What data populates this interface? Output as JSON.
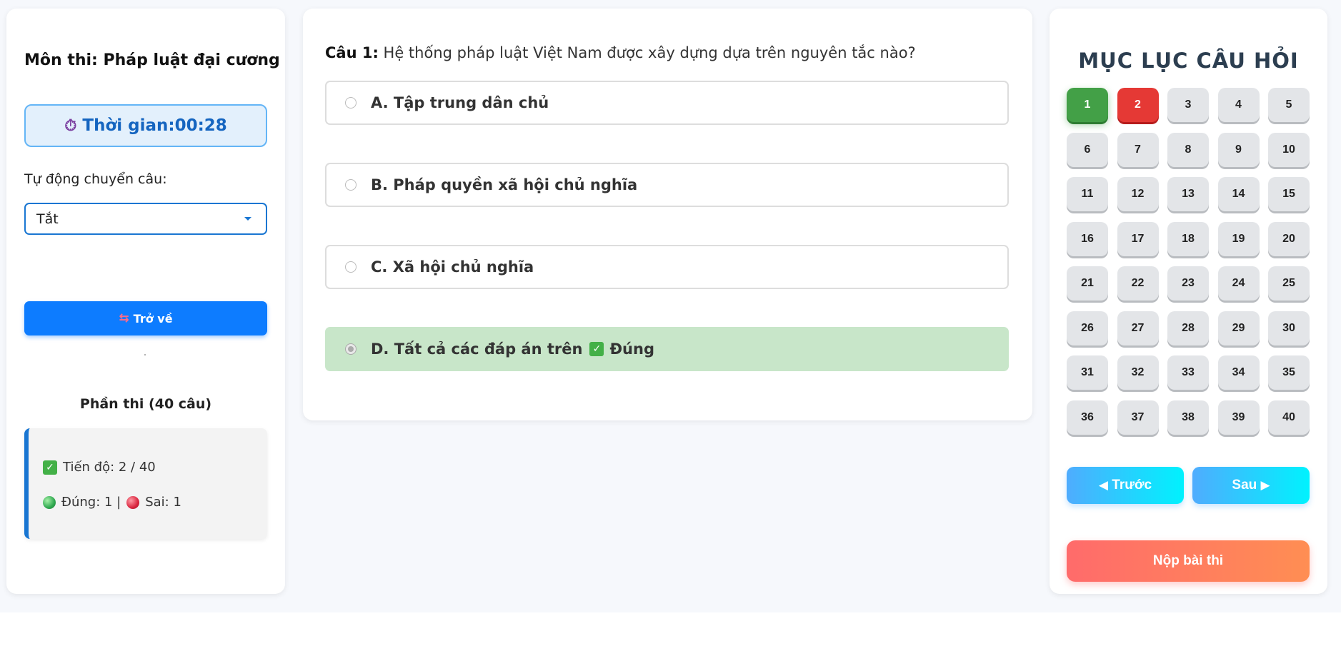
{
  "left": {
    "subject": "Môn thi: Pháp luật đại cương",
    "timer_label": "Thời gian:00:28",
    "auto_label": "Tự động chuyển câu:",
    "auto_value": "Tắt",
    "back_label": "Trở về",
    "section_title": "Phần thi (40 câu)",
    "progress_label": "Tiến độ: 2 / 40",
    "correct_label": "Đúng: 1 |",
    "wrong_label": "Sai: 1"
  },
  "question": {
    "prefix": "Câu 1:",
    "text": "Hệ thống pháp luật Việt Nam được xây dựng dựa trên nguyên tắc nào?",
    "options": [
      {
        "label": "A. Tập trung dân chủ"
      },
      {
        "label": "B. Pháp quyền xã hội chủ nghĩa"
      },
      {
        "label": "C. Xã hội chủ nghĩa"
      },
      {
        "label": "D. Tất cả các đáp án trên",
        "result": "Đúng"
      }
    ]
  },
  "index": {
    "title": "MỤC LỤC CÂU HỎI",
    "questions": [
      "1",
      "2",
      "3",
      "4",
      "5",
      "6",
      "7",
      "8",
      "9",
      "10",
      "11",
      "12",
      "13",
      "14",
      "15",
      "16",
      "17",
      "18",
      "19",
      "20",
      "21",
      "22",
      "23",
      "24",
      "25",
      "26",
      "27",
      "28",
      "29",
      "30",
      "31",
      "32",
      "33",
      "34",
      "35",
      "36",
      "37",
      "38",
      "39",
      "40"
    ],
    "prev_label": "Trước",
    "next_label": "Sau",
    "submit_label": "Nộp bài thi"
  },
  "colors": {
    "correct": "#43a047",
    "wrong": "#e53935",
    "primary": "#0d7cff",
    "correct_option_bg": "#c8e6c9"
  },
  "icons": {
    "timer": "stopwatch-icon",
    "back": "back-arrows-icon",
    "check": "check-mark-icon"
  }
}
